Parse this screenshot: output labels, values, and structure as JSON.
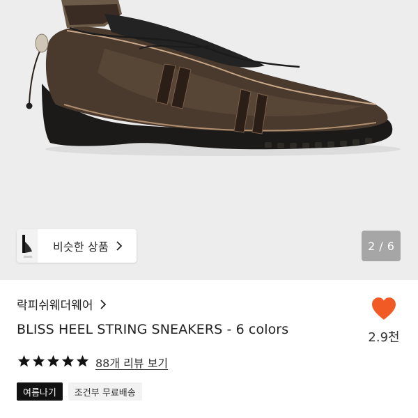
{
  "product_image": {
    "alt": "brown lace-up heeled sneaker",
    "background": "#ededed"
  },
  "similar_products": {
    "label": "비슷한 상품",
    "icon": "chevron-right-icon"
  },
  "pager": {
    "current": "2",
    "separator": "/",
    "total": "6"
  },
  "brand": {
    "name": "락피쉬웨더웨어",
    "icon": "chevron-right-icon"
  },
  "product": {
    "title": "BLISS HEEL STRING SNEAKERS - 6 colors"
  },
  "like": {
    "icon": "heart-icon",
    "count": "2.9천",
    "color": "#f15a24"
  },
  "rating": {
    "stars": 5,
    "max_stars": 5,
    "review_link": "88개 리뷰 보기"
  },
  "tags": [
    {
      "label": "여름나기",
      "style": "dark"
    },
    {
      "label": "조건부 무료배송",
      "style": "light"
    }
  ]
}
